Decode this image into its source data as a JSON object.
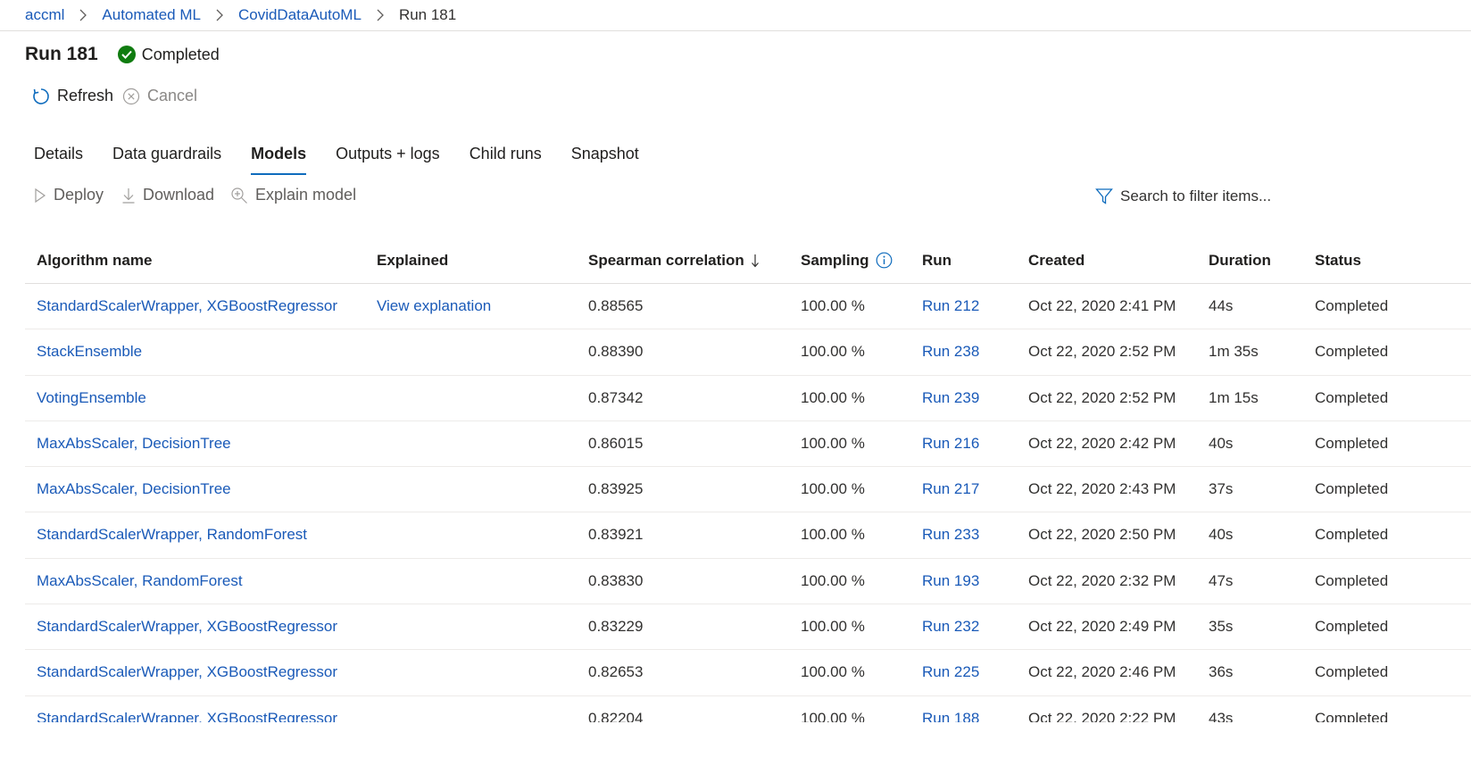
{
  "breadcrumb": {
    "items": [
      "accml",
      "Automated ML",
      "CovidDataAutoML"
    ],
    "current": "Run 181"
  },
  "header": {
    "title": "Run 181",
    "status": "Completed",
    "status_color": "#107c10"
  },
  "commands": {
    "refresh": "Refresh",
    "cancel": "Cancel"
  },
  "tabs": [
    {
      "label": "Details"
    },
    {
      "label": "Data guardrails"
    },
    {
      "label": "Models",
      "active": true
    },
    {
      "label": "Outputs + logs"
    },
    {
      "label": "Child runs"
    },
    {
      "label": "Snapshot"
    }
  ],
  "actions": {
    "deploy": "Deploy",
    "download": "Download",
    "explain": "Explain model"
  },
  "search": {
    "placeholder": "Search to filter items..."
  },
  "table": {
    "columns": [
      "Algorithm name",
      "Explained",
      "Spearman correlation",
      "Sampling",
      "Run",
      "Created",
      "Duration",
      "Status"
    ],
    "sorted_column": "Spearman correlation",
    "sort_direction": "descending",
    "rows": [
      {
        "algorithm": "StandardScalerWrapper, XGBoostRegressor",
        "explained": "View explanation",
        "spearman": "0.88565",
        "sampling": "100.00 %",
        "run": "Run 212",
        "created": "Oct 22, 2020 2:41 PM",
        "duration": "44s",
        "status": "Completed"
      },
      {
        "algorithm": "StackEnsemble",
        "explained": "",
        "spearman": "0.88390",
        "sampling": "100.00 %",
        "run": "Run 238",
        "created": "Oct 22, 2020 2:52 PM",
        "duration": "1m 35s",
        "status": "Completed"
      },
      {
        "algorithm": "VotingEnsemble",
        "explained": "",
        "spearman": "0.87342",
        "sampling": "100.00 %",
        "run": "Run 239",
        "created": "Oct 22, 2020 2:52 PM",
        "duration": "1m 15s",
        "status": "Completed"
      },
      {
        "algorithm": "MaxAbsScaler, DecisionTree",
        "explained": "",
        "spearman": "0.86015",
        "sampling": "100.00 %",
        "run": "Run 216",
        "created": "Oct 22, 2020 2:42 PM",
        "duration": "40s",
        "status": "Completed"
      },
      {
        "algorithm": "MaxAbsScaler, DecisionTree",
        "explained": "",
        "spearman": "0.83925",
        "sampling": "100.00 %",
        "run": "Run 217",
        "created": "Oct 22, 2020 2:43 PM",
        "duration": "37s",
        "status": "Completed"
      },
      {
        "algorithm": "StandardScalerWrapper, RandomForest",
        "explained": "",
        "spearman": "0.83921",
        "sampling": "100.00 %",
        "run": "Run 233",
        "created": "Oct 22, 2020 2:50 PM",
        "duration": "40s",
        "status": "Completed"
      },
      {
        "algorithm": "MaxAbsScaler, RandomForest",
        "explained": "",
        "spearman": "0.83830",
        "sampling": "100.00 %",
        "run": "Run 193",
        "created": "Oct 22, 2020 2:32 PM",
        "duration": "47s",
        "status": "Completed"
      },
      {
        "algorithm": "StandardScalerWrapper, XGBoostRegressor",
        "explained": "",
        "spearman": "0.83229",
        "sampling": "100.00 %",
        "run": "Run 232",
        "created": "Oct 22, 2020 2:49 PM",
        "duration": "35s",
        "status": "Completed"
      },
      {
        "algorithm": "StandardScalerWrapper, XGBoostRegressor",
        "explained": "",
        "spearman": "0.82653",
        "sampling": "100.00 %",
        "run": "Run 225",
        "created": "Oct 22, 2020 2:46 PM",
        "duration": "36s",
        "status": "Completed"
      },
      {
        "algorithm": "StandardScalerWrapper, XGBoostRegressor",
        "explained": "",
        "spearman": "0.82204",
        "sampling": "100.00 %",
        "run": "Run 188",
        "created": "Oct 22, 2020 2:22 PM",
        "duration": "43s",
        "status": "Completed"
      }
    ]
  },
  "colors": {
    "link": "#1a5ab8",
    "accent": "#0f6cbd",
    "text": "#201f1e",
    "muted": "#605e5c"
  }
}
